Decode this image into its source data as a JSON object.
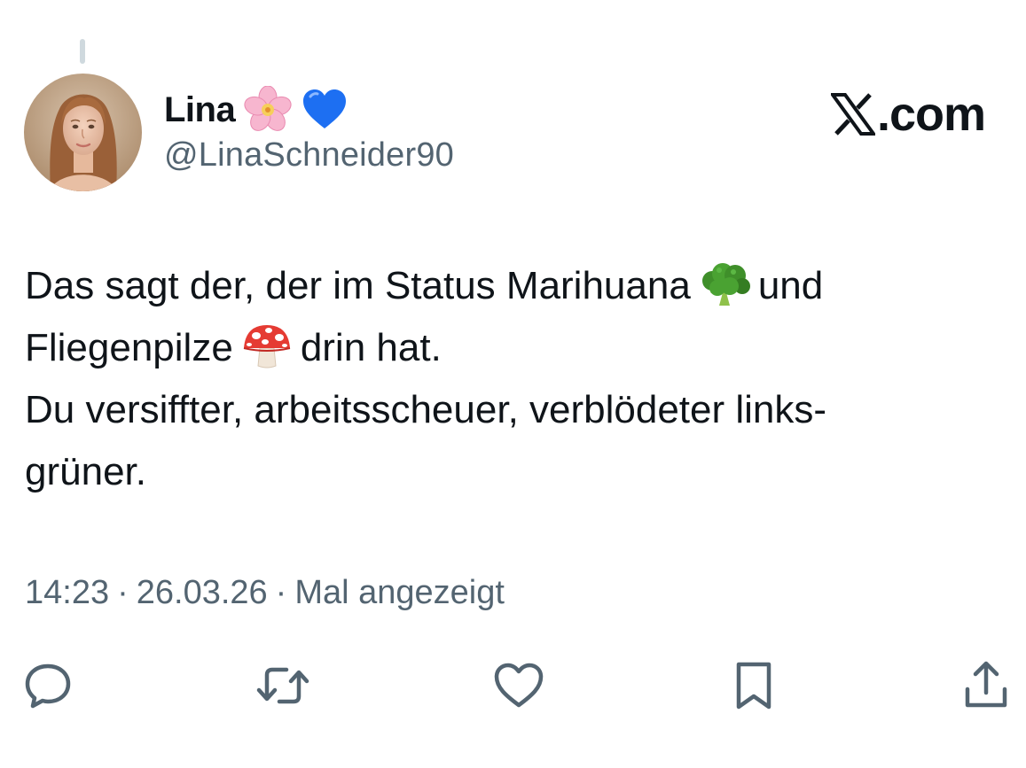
{
  "author": {
    "display_name": "Lina",
    "name_emojis": [
      "cherry-blossom-icon",
      "blue-heart-icon"
    ],
    "handle": "@LinaSchneider90"
  },
  "brand": {
    "label": ".com",
    "logo_icon": "x-logo-icon"
  },
  "tweet": {
    "line1_before": "Das sagt der, der im Status Marihuana",
    "line1_after": "und",
    "line2_before": "Fliegenpilze",
    "line2_after": "drin hat.",
    "line3": "Du versiffter, arbeitsscheuer, verblödeter links-",
    "line4": "grüner.",
    "emojis": [
      "broccoli-icon",
      "mushroom-icon"
    ]
  },
  "meta": {
    "time": "14:23",
    "separator": "·",
    "date": "26.03.26",
    "views": "Mal angezeigt"
  },
  "actions": [
    "reply-icon",
    "retweet-icon",
    "like-icon",
    "bookmark-icon",
    "share-icon"
  ],
  "colors": {
    "text": "#0f1419",
    "secondary": "#536471",
    "thread_line": "#cfd9de"
  }
}
